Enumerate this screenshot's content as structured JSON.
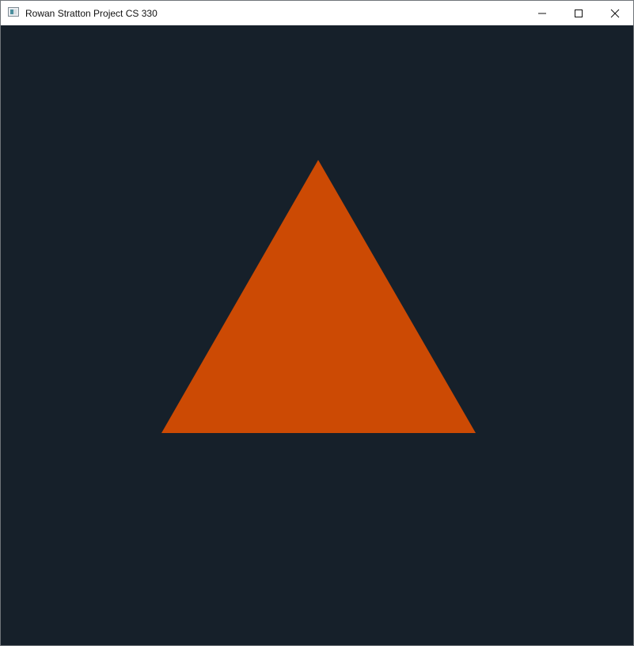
{
  "window": {
    "title": "Rowan Stratton Project CS 330",
    "controls": {
      "minimize": "minimize-icon",
      "maximize": "maximize-icon",
      "close": "close-icon"
    }
  },
  "viewport": {
    "background_color": "#16202a"
  },
  "shape": {
    "type": "triangle",
    "fill_color": "#cc4a04"
  }
}
